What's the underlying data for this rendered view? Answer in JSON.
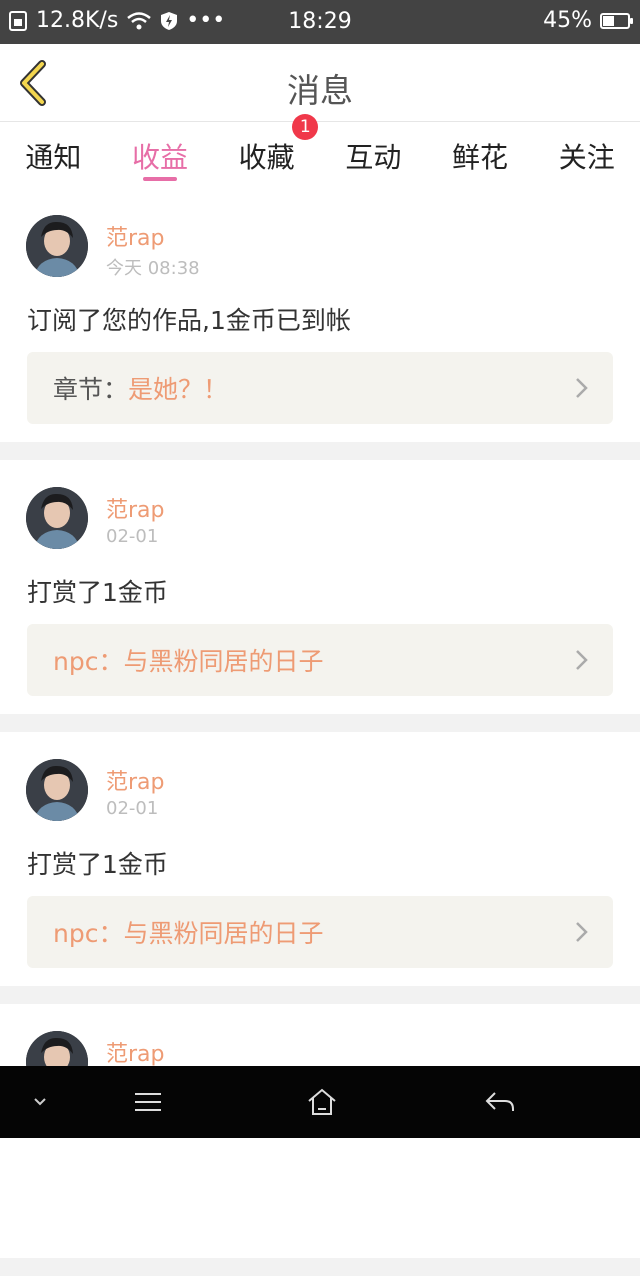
{
  "status_bar": {
    "network_speed": "12.8K/s",
    "time": "18:29",
    "battery": "45%",
    "battery_level": 0.45,
    "more": "•••"
  },
  "nav": {
    "title": "消息",
    "back_icon": "chevron-left-icon",
    "accent_color": "#e76ea7"
  },
  "tabs": [
    {
      "label": "通知",
      "active": false
    },
    {
      "label": "收益",
      "active": true
    },
    {
      "label": "收藏",
      "active": false,
      "badge": "1"
    },
    {
      "label": "互动",
      "active": false
    },
    {
      "label": "鲜花",
      "active": false
    },
    {
      "label": "关注",
      "active": false
    }
  ],
  "messages": [
    {
      "name": "范rap",
      "time": "今天 08:38",
      "text": "订阅了您的作品,1金币已到帐",
      "link_prefix": "章节：",
      "link_title": "是她？！"
    },
    {
      "name": "范rap",
      "time": "02-01",
      "text": "打赏了1金币",
      "link_prefix": "npc：",
      "link_title": "与黑粉同居的日子"
    },
    {
      "name": "范rap",
      "time": "02-01",
      "text": "打赏了1金币",
      "link_prefix": "npc：",
      "link_title": "与黑粉同居的日子"
    },
    {
      "name": "范rap",
      "time": "",
      "text": "",
      "link_prefix": "",
      "link_title": ""
    }
  ],
  "colors": {
    "name": "#ee9b74",
    "badge": "#f0384a",
    "link_bg": "#f4f3ee"
  },
  "system_nav": [
    "chevron-down-icon",
    "menu-icon",
    "home-icon",
    "back-arrow-icon"
  ]
}
